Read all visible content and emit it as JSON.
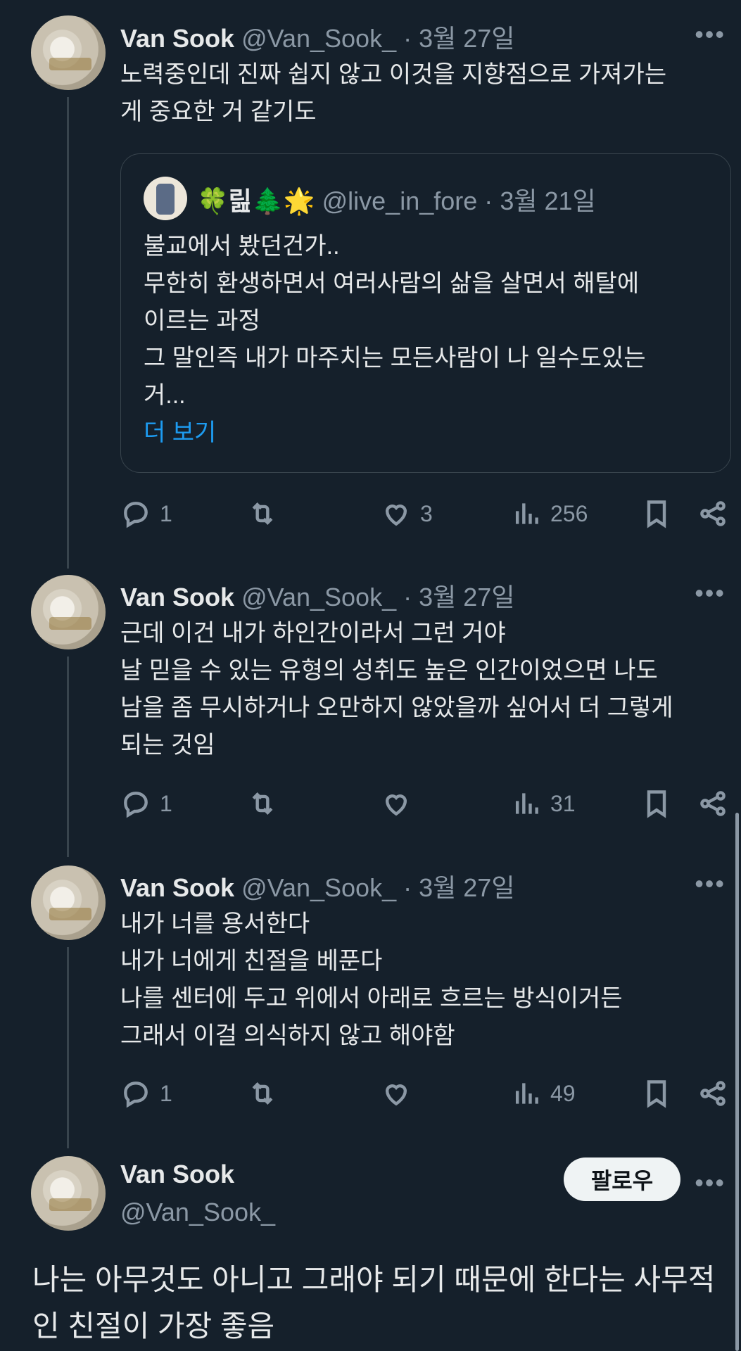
{
  "tweets": [
    {
      "name": "Van Sook",
      "handle": "@Van_Sook_",
      "dot": "·",
      "date": "3월 27일",
      "lines": [
        "노력중인데 진짜 쉽지 않고 이것을 지향점으로 가져가는",
        "게 중요한 거 같기도"
      ],
      "quote": {
        "name": "🍀릺🌲🌟",
        "handle": "@live_in_fore",
        "dot": "·",
        "date": "3월 21일",
        "lines": [
          "불교에서 봤던건가..",
          "무한히 환생하면서 여러사람의 삶을 살면서 해탈에",
          "이르는 과정",
          "그 말인즉 내가 마주치는 모든사람이 나 일수도있는",
          "거..."
        ],
        "show_more": "더 보기"
      },
      "replies": "1",
      "retweets": "",
      "likes": "3",
      "views": "256"
    },
    {
      "name": "Van Sook",
      "handle": "@Van_Sook_",
      "dot": "·",
      "date": "3월 27일",
      "lines": [
        "근데 이건 내가 하인간이라서 그런 거야",
        "날 믿을 수 있는 유형의 성취도 높은 인간이었으면 나도",
        "남을 좀 무시하거나 오만하지 않았을까 싶어서 더 그렇게",
        "되는 것임"
      ],
      "replies": "1",
      "retweets": "",
      "likes": "",
      "views": "31"
    },
    {
      "name": "Van Sook",
      "handle": "@Van_Sook_",
      "dot": "·",
      "date": "3월 27일",
      "lines": [
        "내가 너를 용서한다",
        "내가 너에게 친절을 베푼다",
        "나를 센터에 두고 위에서 아래로 흐르는 방식이거든",
        "그래서 이걸 의식하지 않고 해야함"
      ],
      "replies": "1",
      "retweets": "",
      "likes": "",
      "views": "49"
    }
  ],
  "main_tweet": {
    "name": "Van Sook",
    "handle": "@Van_Sook_",
    "follow_label": "팔로우",
    "lines": [
      "나는 아무것도 아니고 그래야 되기 때문에 한다는 사무적",
      "인 친절이 가장 좋음"
    ]
  },
  "icons": {
    "reply": "reply-icon",
    "retweet": "retweet-icon",
    "like": "heart-icon",
    "views": "views-icon",
    "bookmark": "bookmark-icon",
    "share": "share-icon",
    "more": "more-icon"
  },
  "colors": {
    "background": "#15202b",
    "text": "#e7e9ea",
    "secondary": "#8b98a5",
    "link": "#1d9bf0",
    "border": "#38444d"
  }
}
